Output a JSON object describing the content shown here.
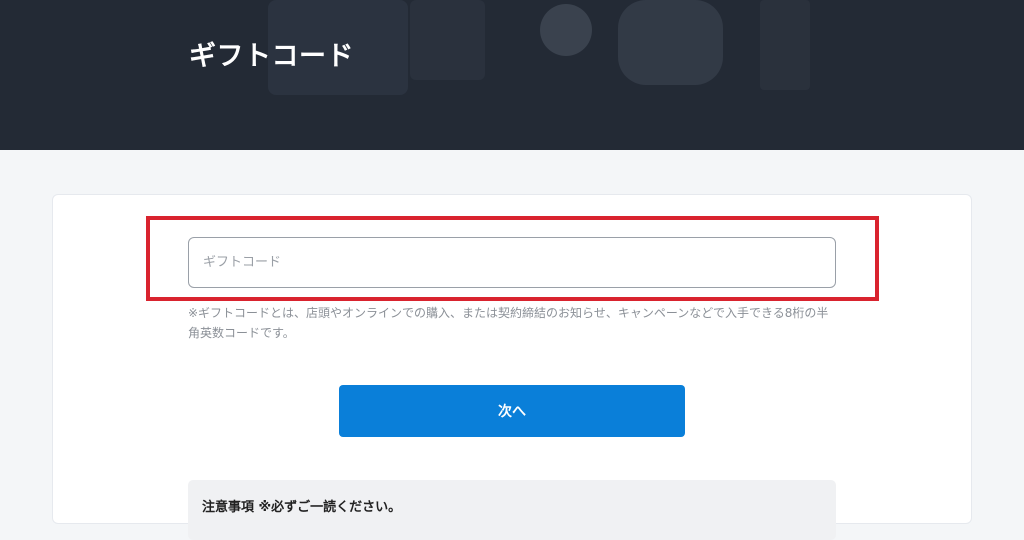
{
  "header": {
    "title": "ギフトコード"
  },
  "form": {
    "code_placeholder": "ギフトコード",
    "code_value": "",
    "note": "※ギフトコードとは、店頭やオンラインでの購入、または契約締結のお知らせ、キャンペーンなどで入手できる8桁の半角英数コードです。",
    "next_label": "次へ"
  },
  "notice": {
    "title": "注意事項 ※必ずご一読ください。"
  },
  "colors": {
    "header_bg": "#232a35",
    "accent": "#0a7fd9",
    "highlight": "#d9232e"
  }
}
